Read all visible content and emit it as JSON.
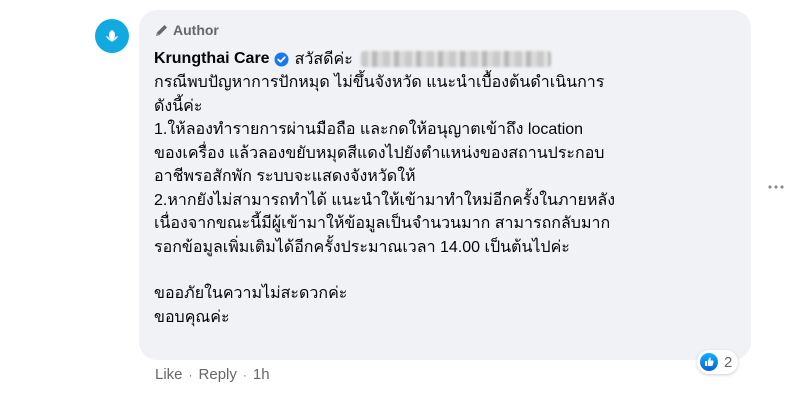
{
  "comment": {
    "author_badge": "Author",
    "page_name": "Krungthai Care",
    "greeting": "สวัสดีค่ะ",
    "body_lines": [
      "กรณีพบปัญหาการปักหมุด ไม่ขึ้นจังหวัด แนะนำเบื้องต้นดำเนินการ",
      "ดังนี้ค่ะ",
      "1.ให้ลองทำรายการผ่านมือถือ และกดให้อนุญาตเข้าถึง location",
      "ของเครื่อง แล้วลองขยับหมุดสีแดงไปยังตำแหน่งของสถานประกอบ",
      "อาชีพรอสักพัก ระบบจะแสดงจังหวัดให้",
      "2.หากยังไม่สามารถทำได้ แนะนำให้เข้ามาทำใหม่อีกครั้งในภายหลัง",
      "เนื่องจากขณะนี้มีผู้เข้ามาให้ข้อมูลเป็นจำนวนมาก สามารถกลับมาก",
      "รอกข้อมูลเพิ่มเติมได้อีกครั้งประมาณเวลา 14.00 เป็นต้นไปค่ะ"
    ],
    "closing_lines": [
      "ขออภัยในความไม่สะดวกค่ะ",
      "ขอบคุณค่ะ"
    ],
    "reaction_count": "2",
    "actions": {
      "like": "Like",
      "separator": "·",
      "reply": "Reply",
      "time": "1h"
    }
  },
  "icons": {
    "avatar": "krungthai-logo-icon",
    "badge": "pen-icon",
    "verified": "verified-check-icon",
    "reaction": "like-thumb-icon",
    "menu": "more-options-icon"
  },
  "colors": {
    "bubble": "#f0f2f5",
    "secondary_text": "#65676b",
    "verified": "#1877f2",
    "avatar": "#12a9e0"
  }
}
